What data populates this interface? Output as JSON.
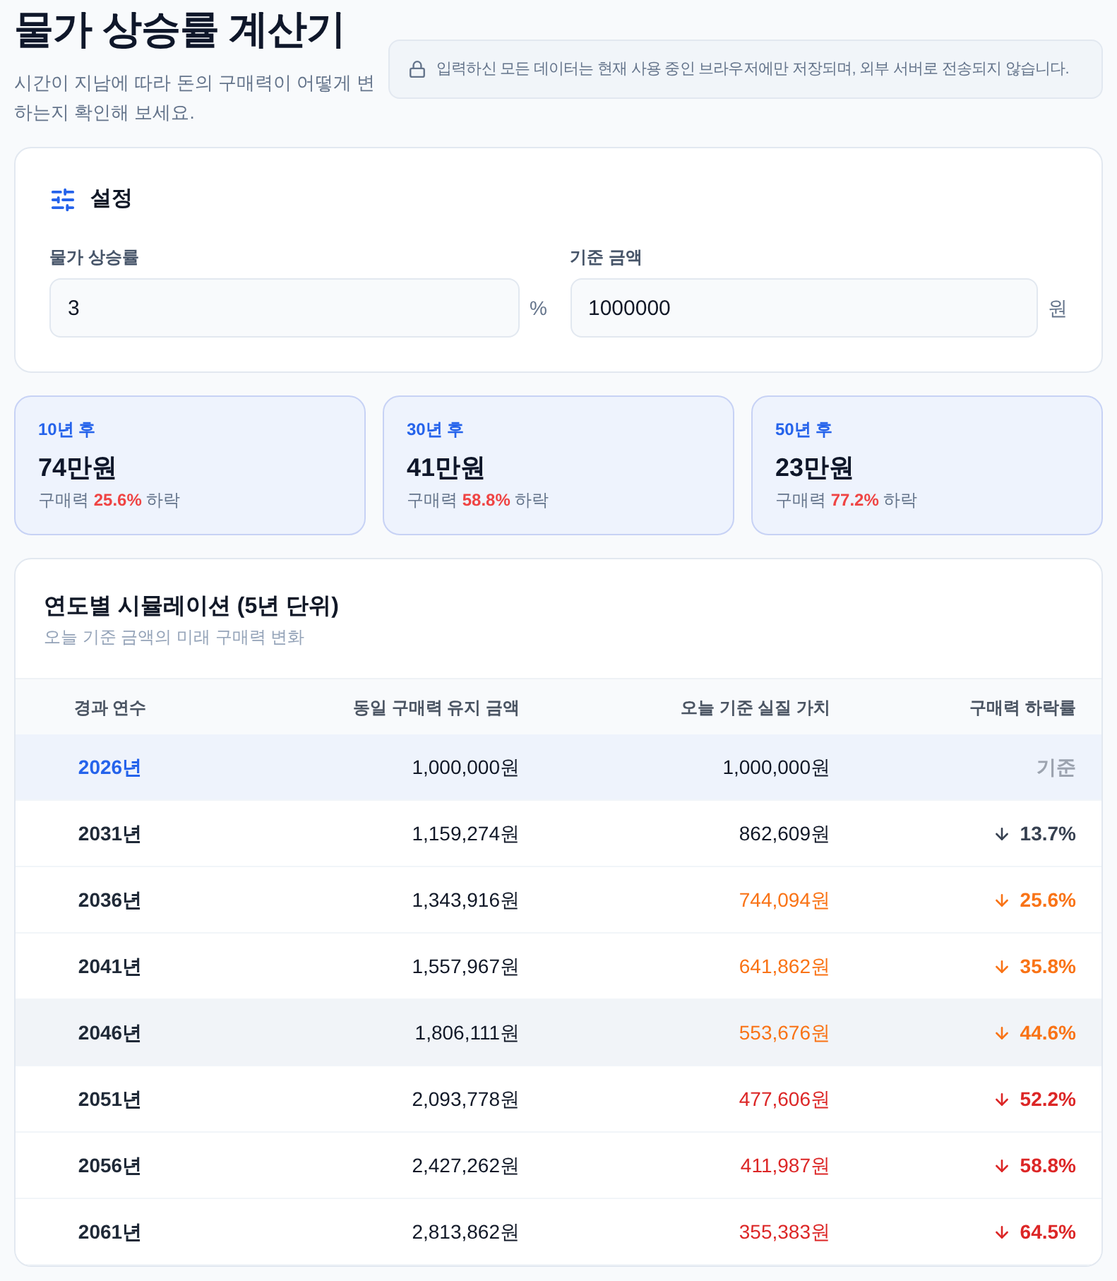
{
  "header": {
    "title": "물가 상승률 계산기",
    "subtitle": "시간이 지남에 따라 돈의 구매력이 어떻게 변하는지 확인해 보세요."
  },
  "notice": {
    "text": "입력하신 모든 데이터는 현재 사용 중인 브라우저에만 저장되며, 외부 서버로 전송되지 않습니다."
  },
  "settings": {
    "title": "설정",
    "fields": [
      {
        "label": "물가 상승률",
        "value": "3",
        "unit": "%"
      },
      {
        "label": "기준 금액",
        "value": "1000000",
        "unit": "원"
      }
    ]
  },
  "summary_cards": [
    {
      "label": "10년 후",
      "value": "74만원",
      "caption": "구매력 **25.6%** 하락"
    },
    {
      "label": "30년 후",
      "value": "41만원",
      "caption": "구매력 **58.8%** 하락"
    },
    {
      "label": "50년 후",
      "value": "23만원",
      "caption": "구매력 **77.2%** 하락"
    }
  ],
  "table": {
    "title": "연도별 시뮬레이션 (5년 단위)",
    "subtitle": "오늘 기준 금액의 미래 구매력 변화",
    "columns": [
      "경과 연수",
      "동일 구매력 유지 금액",
      "오늘 기준 실질 가치",
      "구매력 하락률"
    ],
    "rows": [
      {
        "kind": "base",
        "hovered": false,
        "year": "2026년",
        "amount": "1,000,000원",
        "real_value": "1,000,000원",
        "decline": "기준"
      },
      {
        "kind": "normal",
        "hovered": false,
        "year": "2031년",
        "amount": "1,159,274원",
        "real_value": "862,609원",
        "decline": "13.7%"
      },
      {
        "kind": "warn",
        "hovered": false,
        "year": "2036년",
        "amount": "1,343,916원",
        "real_value": "744,094원",
        "decline": "25.6%"
      },
      {
        "kind": "warn",
        "hovered": false,
        "year": "2041년",
        "amount": "1,557,967원",
        "real_value": "641,862원",
        "decline": "35.8%"
      },
      {
        "kind": "warn",
        "hovered": true,
        "year": "2046년",
        "amount": "1,806,111원",
        "real_value": "553,676원",
        "decline": "44.6%"
      },
      {
        "kind": "danger",
        "hovered": false,
        "year": "2051년",
        "amount": "2,093,778원",
        "real_value": "477,606원",
        "decline": "52.2%"
      },
      {
        "kind": "danger",
        "hovered": false,
        "year": "2056년",
        "amount": "2,427,262원",
        "real_value": "411,987원",
        "decline": "58.8%"
      },
      {
        "kind": "danger",
        "hovered": false,
        "year": "2061년",
        "amount": "2,813,862원",
        "real_value": "355,383원",
        "decline": "64.5%"
      }
    ]
  }
}
